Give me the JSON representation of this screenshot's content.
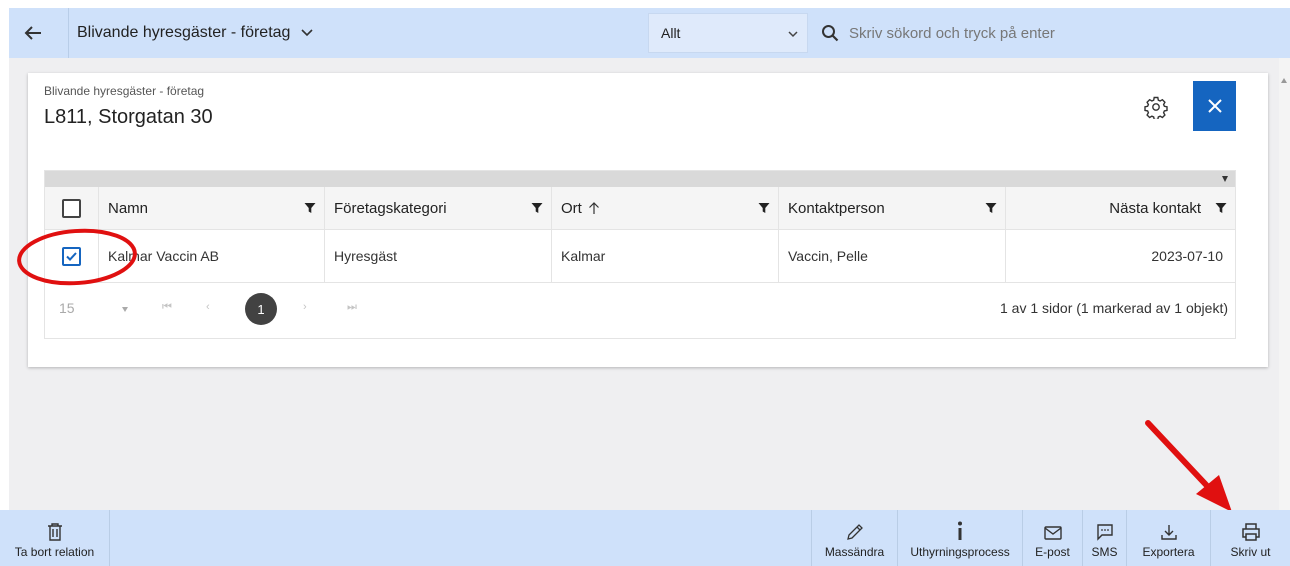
{
  "topbar": {
    "back_icon": "arrow-left-icon",
    "title": "Blivande hyresgäster - företag",
    "filter_value": "Allt",
    "search_placeholder": "Skriv sökord och tryck på enter"
  },
  "card": {
    "subtitle": "Blivande hyresgäster - företag",
    "title": "L811, Storgatan 30"
  },
  "grid": {
    "columns": [
      "Namn",
      "Företagskategori",
      "Ort",
      "Kontaktperson",
      "Nästa kontakt"
    ],
    "sorted_column": "Ort",
    "sort_direction": "ascending",
    "rows": [
      {
        "checked": true,
        "namn": "Kalmar Vaccin AB",
        "kategori": "Hyresgäst",
        "ort": "Kalmar",
        "kontakt": "Vaccin, Pelle",
        "nasta": "2023-07-10"
      }
    ]
  },
  "pager": {
    "page_size": "15",
    "current_page": "1",
    "info": "1 av 1 sidor (1 markerad av 1 objekt)"
  },
  "toolbar": {
    "delete": "Ta bort relation",
    "bulk_edit": "Massändra",
    "process": "Uthyrningsprocess",
    "email": "E-post",
    "sms": "SMS",
    "export": "Exportera",
    "print": "Skriv ut"
  },
  "colors": {
    "bar": "#cfe1fa",
    "accent": "#1565c0",
    "annotation": "#e01010"
  }
}
